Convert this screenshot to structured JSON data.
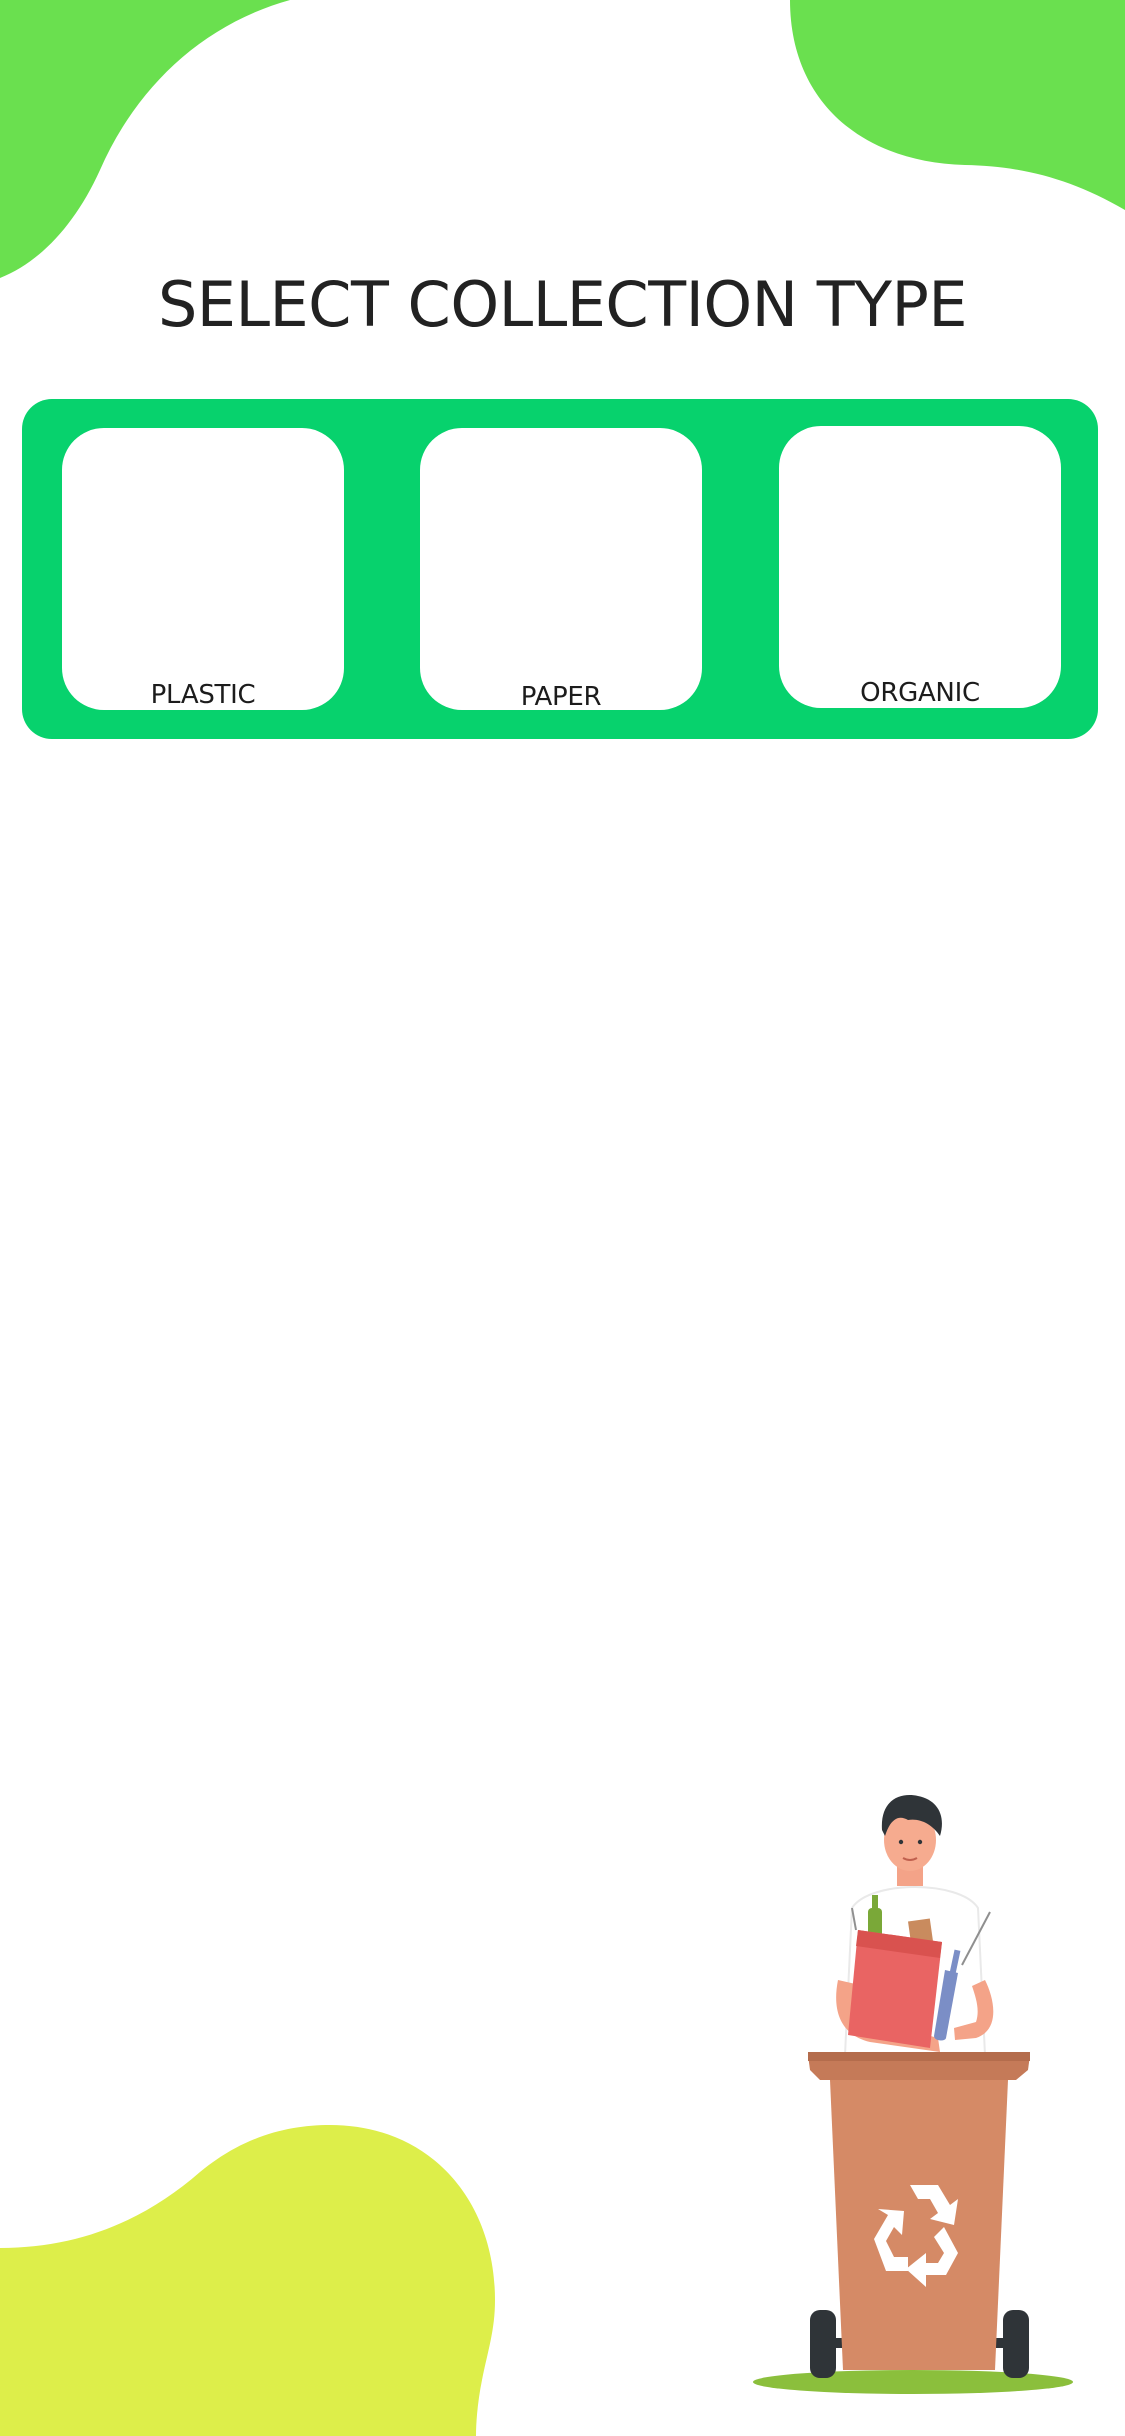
{
  "screen": {
    "title": "SELECT COLLECTION TYPE"
  },
  "collection_types": [
    {
      "label": "PLASTIC"
    },
    {
      "label": "PAPER"
    },
    {
      "label": "ORGANIC"
    }
  ],
  "colors": {
    "panel": "#07d26d",
    "blob_top": "#6ae04f",
    "blob_bottom": "#ddee4a",
    "title_text": "#222222",
    "bin": "#d58a66",
    "bin_lid": "#c57a58"
  },
  "icons": {
    "recycle": "recycle-icon",
    "illustration": "person-recycling-illustration"
  }
}
